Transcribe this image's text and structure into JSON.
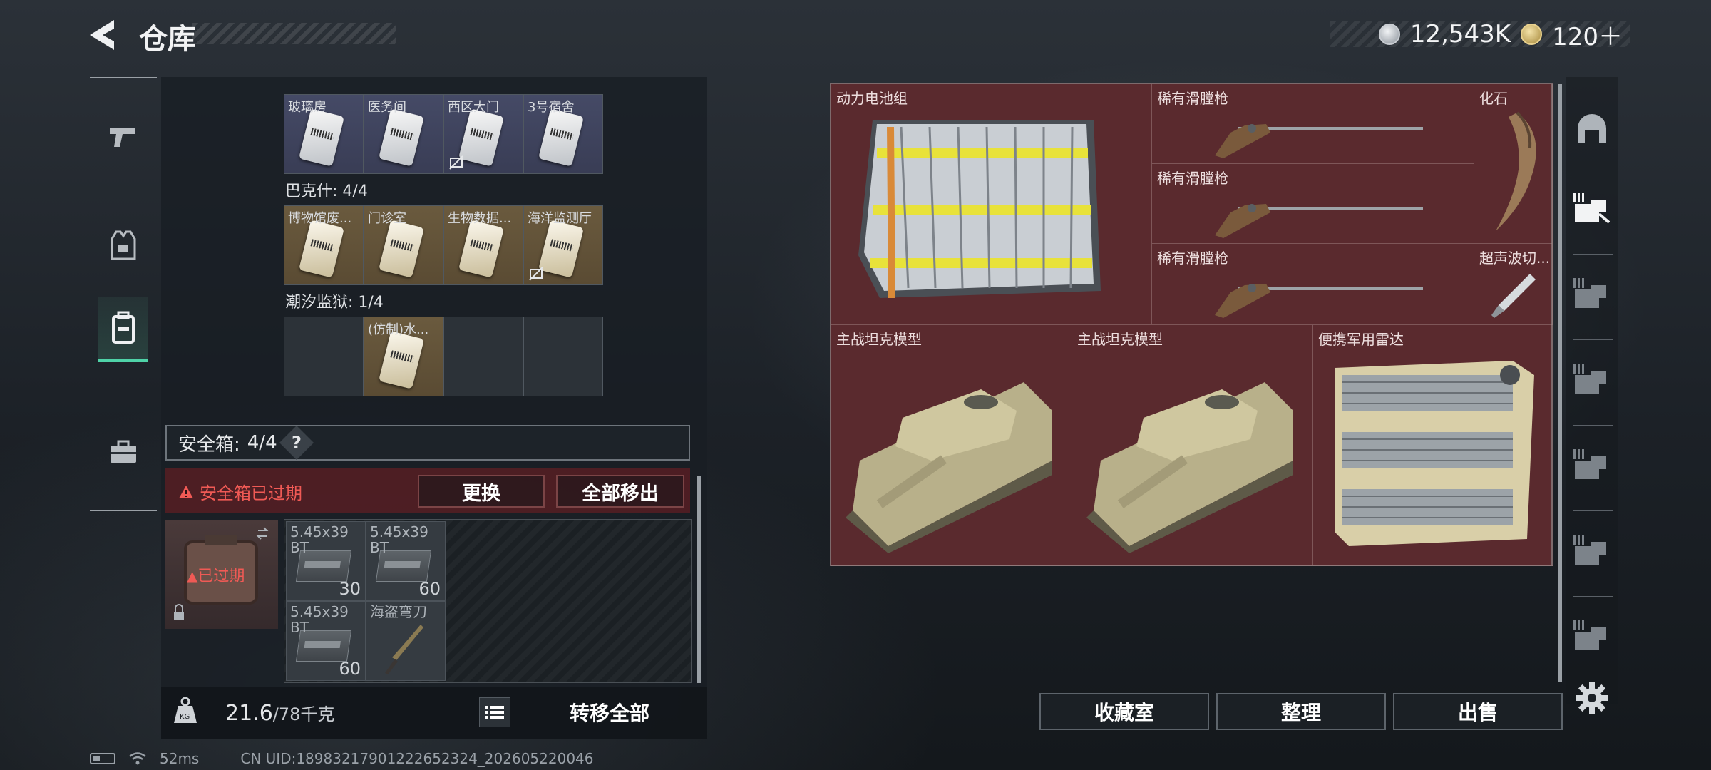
{
  "header": {
    "title": "仓库"
  },
  "currency": {
    "silver": "12,543K",
    "gold": "120＋"
  },
  "left_panel": {
    "groups": [
      {
        "label": "",
        "items": [
          {
            "name": "玻璃房",
            "rarity": "blue"
          },
          {
            "name": "医务间",
            "rarity": "blue"
          },
          {
            "name": "西区大门",
            "rarity": "blue",
            "badge": true
          },
          {
            "name": "3号宿舍",
            "rarity": "blue"
          }
        ]
      },
      {
        "label": "巴克什: 4/4",
        "items": [
          {
            "name": "博物馆废...",
            "rarity": "gold"
          },
          {
            "name": "门诊室",
            "rarity": "gold"
          },
          {
            "name": "生物数据...",
            "rarity": "gold"
          },
          {
            "name": "海洋监测厅",
            "rarity": "gold",
            "badge": true
          }
        ]
      },
      {
        "label": "潮汐监狱: 1/4",
        "items": [
          {
            "name": "",
            "rarity": "dark"
          },
          {
            "name": "(仿制)水...",
            "rarity": "gold"
          },
          {
            "name": "",
            "rarity": "dark"
          },
          {
            "name": "",
            "rarity": "dark"
          }
        ]
      }
    ]
  },
  "safe_box": {
    "label": "安全箱:",
    "count": "4/4",
    "help": "?",
    "expired_warning": "安全箱已过期",
    "swap_label": "更换",
    "move_all_label": "全部移出",
    "icon_status": "已过期",
    "items": [
      {
        "name": "5.45x39",
        "sub": "BT",
        "qty": "30"
      },
      {
        "name": "5.45x39",
        "sub": "BT",
        "qty": "60"
      },
      {
        "name": "5.45x39",
        "sub": "BT",
        "qty": "60"
      },
      {
        "name": "海盗弯刀",
        "sub": "",
        "qty": ""
      }
    ]
  },
  "weight": {
    "current": "21.6",
    "max": "/78千克"
  },
  "transfer_all": "转移全部",
  "status": {
    "ping": "52ms",
    "uid": "CN UID:1898321790122265232­4_202605220046"
  },
  "storage": {
    "items": [
      {
        "name": "动力电池组"
      },
      {
        "name": "稀有滑膛枪"
      },
      {
        "name": "化石"
      },
      {
        "name": "稀有滑膛枪"
      },
      {
        "name": "稀有滑膛枪"
      },
      {
        "name": "超声波切..."
      },
      {
        "name": "主战坦克模型"
      },
      {
        "name": "主战坦克模型"
      },
      {
        "name": "便携军用雷达"
      }
    ]
  },
  "bottom_actions": {
    "collection": "收藏室",
    "organize": "整理",
    "sell": "出售"
  },
  "colors": {
    "accent_green": "#4fd3a8",
    "warning_red": "#f05a55",
    "storage_bg": "#5a2a2e"
  }
}
